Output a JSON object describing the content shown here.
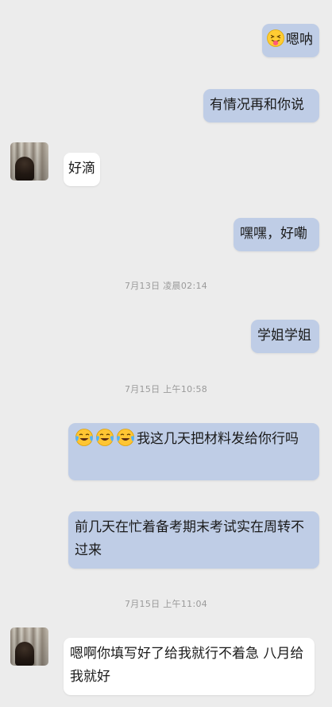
{
  "messages": [
    {
      "side": "me",
      "text": "嗯呐",
      "emoji": "tongue-face-icon"
    },
    {
      "side": "me",
      "text": "有情况再和你说"
    },
    {
      "side": "them",
      "text": "好滴"
    },
    {
      "side": "me",
      "text": "嘿嘿，好嘞"
    },
    {
      "side": "me",
      "text": "学姐学姐"
    },
    {
      "side": "me",
      "text": "我这几天把材料发给你行吗",
      "emoji": "tears-of-joy-icon"
    },
    {
      "side": "me",
      "text": "前几天在忙着备考期末考试实在周转不过来"
    },
    {
      "side": "them",
      "text": "嗯啊你填写好了给我就行不着急 八月给我就好"
    }
  ],
  "timestamps": [
    "7月13日 凌晨02:14",
    "7月15日 上午10:58",
    "7月15日 上午11:04"
  ],
  "colors": {
    "bg": "#ececec",
    "me_bubble": "#bfcde6",
    "them_bubble": "#ffffff"
  }
}
